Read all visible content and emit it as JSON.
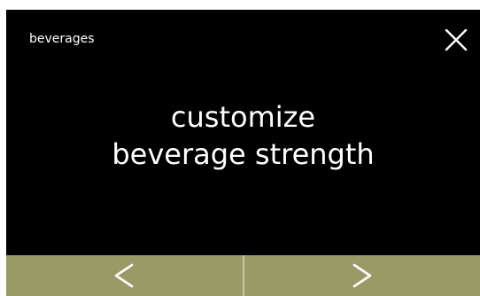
{
  "header": {
    "title": "beverages",
    "close_icon": "close-icon"
  },
  "main": {
    "message_line1": "customize",
    "message_line2": "beverage strength"
  },
  "footer": {
    "prev_icon": "chevron-left-icon",
    "next_icon": "chevron-right-icon",
    "button_color": "#999a66"
  },
  "colors": {
    "background": "#000000",
    "text": "#ffffff"
  }
}
